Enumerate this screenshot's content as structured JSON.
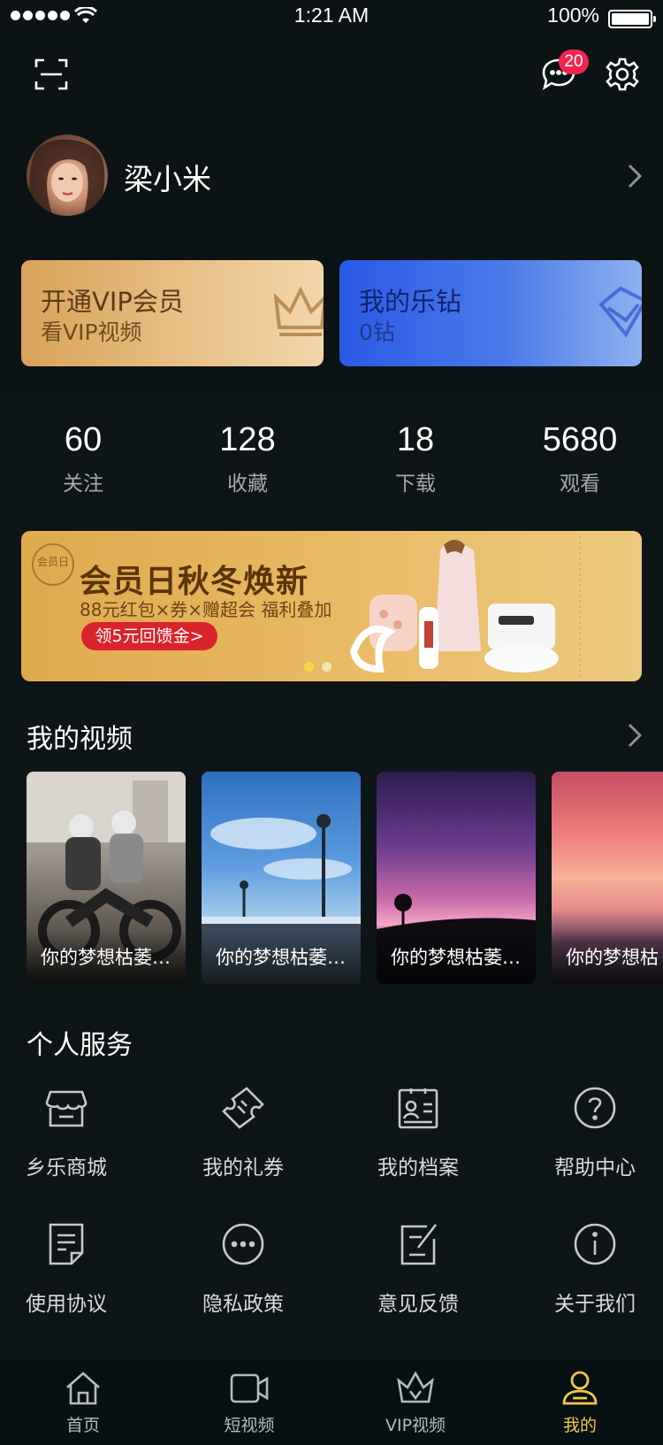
{
  "status_bar": {
    "time": "1:21 AM",
    "battery": "100%"
  },
  "header": {
    "message_badge": "20"
  },
  "profile": {
    "name": "梁小米"
  },
  "vip_card": {
    "title": "开通VIP会员",
    "subtitle": "看VIP视频"
  },
  "diamond_card": {
    "title": "我的乐钻",
    "subtitle": "0钻"
  },
  "stats": [
    {
      "value": "60",
      "label": "关注"
    },
    {
      "value": "128",
      "label": "收藏"
    },
    {
      "value": "18",
      "label": "下载"
    },
    {
      "value": "5680",
      "label": "观看"
    }
  ],
  "banner": {
    "badge_text": "会员日",
    "title": "会员日秋冬焕新",
    "subtitle": "88元红包×券×赠超会 福利叠加",
    "button": "领5元回馈金>"
  },
  "my_videos": {
    "title": "我的视频",
    "items": [
      {
        "caption": "你的梦想枯萎…"
      },
      {
        "caption": "你的梦想枯萎…"
      },
      {
        "caption": "你的梦想枯萎…"
      },
      {
        "caption": "你的梦想枯"
      }
    ]
  },
  "services": {
    "title": "个人服务",
    "items": [
      {
        "label": "乡乐商城",
        "icon": "store-icon"
      },
      {
        "label": "我的礼券",
        "icon": "ticket-icon"
      },
      {
        "label": "我的档案",
        "icon": "profile-card-icon"
      },
      {
        "label": "帮助中心",
        "icon": "help-icon"
      },
      {
        "label": "使用协议",
        "icon": "document-icon"
      },
      {
        "label": "隐私政策",
        "icon": "more-dots-icon"
      },
      {
        "label": "意见反馈",
        "icon": "feedback-icon"
      },
      {
        "label": "关于我们",
        "icon": "info-icon"
      }
    ]
  },
  "tabbar": {
    "items": [
      {
        "label": "首页",
        "icon": "home-icon"
      },
      {
        "label": "短视频",
        "icon": "video-camera-icon"
      },
      {
        "label": "VIP视频",
        "icon": "crown-icon"
      },
      {
        "label": "我的",
        "icon": "user-icon"
      }
    ],
    "active_index": 3
  },
  "colors": {
    "background": "#0b1314",
    "accent": "#f3c94a",
    "badge": "#f3254f",
    "vip_gold": "#e0a94e",
    "diamond_blue": "#2a5ae6"
  }
}
